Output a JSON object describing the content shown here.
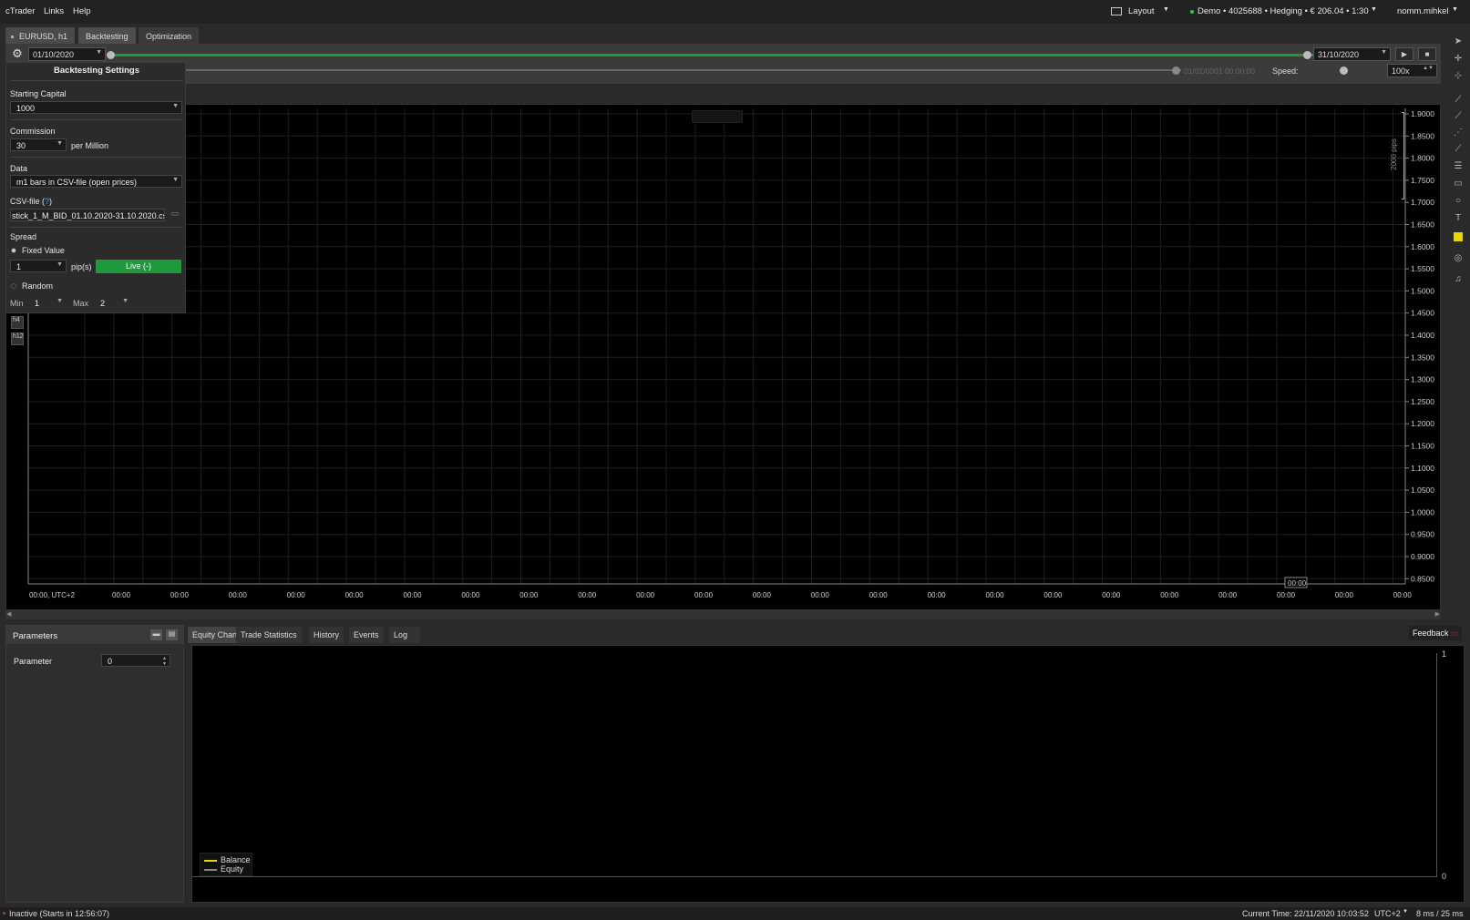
{
  "menubar": {
    "items": [
      "cTrader",
      "Links",
      "Help"
    ],
    "layout_label": "Layout",
    "account_info": "Demo • 4025688 • Hedging • € 206.04 • 1:30",
    "username": "nomm.mihkel"
  },
  "tabs": {
    "symbol_tab": "EURUSD, h1",
    "backtesting_tab": "Backtesting",
    "optimization_tab": "Optimization"
  },
  "toolbar": {
    "start_date": "01/10/2020",
    "end_date": "31/10/2020",
    "current_time_value": "01/01/0001 00:00:00",
    "speed_label": "Speed:",
    "speed_value": "100x"
  },
  "settings_panel": {
    "title": "Backtesting Settings",
    "starting_capital_label": "Starting Capital",
    "starting_capital_value": "1000",
    "commission_label": "Commission",
    "commission_value": "30",
    "commission_unit": "per Million",
    "data_label": "Data",
    "data_value": "m1 bars in CSV-file (open prices)",
    "csv_label": "CSV-file (",
    "csv_help": "?",
    "csv_label_end": ")",
    "csv_value": "stick_1_M_BID_01.10.2020-31.10.2020.csv",
    "spread_label": "Spread",
    "fixed_value_label": "Fixed Value",
    "fixed_value": "1",
    "pips_label": "pip(s)",
    "live_button": "Live (-)",
    "random_label": "Random",
    "min_label": "Min",
    "min_value": "1",
    "max_label": "Max",
    "max_value": "2"
  },
  "chart": {
    "y_ticks": [
      "1.9000",
      "1.8500",
      "1.8000",
      "1.7500",
      "1.7000",
      "1.6500",
      "1.6000",
      "1.5500",
      "1.5000",
      "1.4500",
      "1.4000",
      "1.3500",
      "1.3000",
      "1.2500",
      "1.2000",
      "1.1500",
      "1.1000",
      "1.0500",
      "1.0000",
      "0.9500",
      "0.9000",
      "0.8500"
    ],
    "x_first": "00:00, UTC+2",
    "x_tick": "00:00",
    "x_marker": "00:00",
    "pips_label": "2000 pips",
    "timeframe_buttons": [
      "h4",
      "h12"
    ]
  },
  "parameters_panel": {
    "title": "Parameters",
    "param_name": "Parameter",
    "param_value": "0"
  },
  "bottom_tabs": {
    "tabs": [
      "Equity Chart",
      "Trade Statistics",
      "History",
      "Events",
      "Log"
    ],
    "feedback": "Feedback"
  },
  "equity_chart": {
    "y_top": "1",
    "y_bottom": "0",
    "legend": [
      {
        "name": "Balance",
        "color": "#e6d800"
      },
      {
        "name": "Equity",
        "color": "#888888"
      }
    ]
  },
  "statusbar": {
    "status": "Inactive (Starts in 12:56:07)",
    "current_time_label": "Current Time:",
    "current_time_value": "22/11/2020 10:03:52",
    "timezone": "UTC+2",
    "latency": "8 ms / 25 ms"
  },
  "colors": {
    "accent_green": "#1e9a3c",
    "status_red": "#d03030",
    "online_green": "#2ecc40"
  }
}
